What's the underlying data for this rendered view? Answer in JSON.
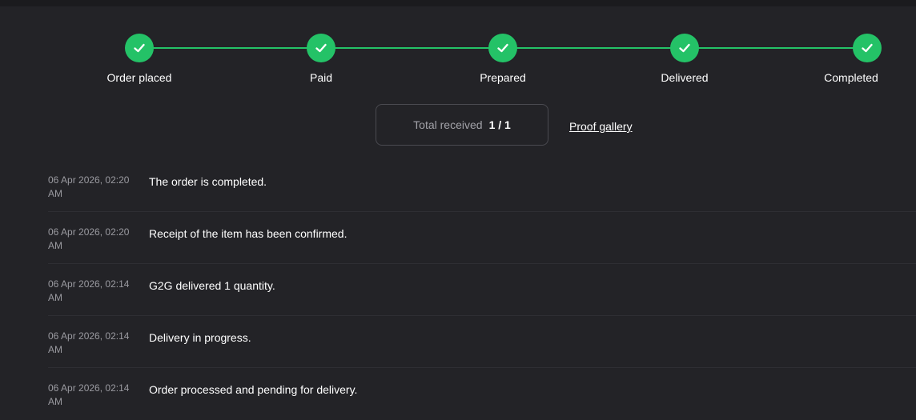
{
  "stepper": {
    "color": "#24c267",
    "steps": [
      {
        "label": "Order placed",
        "status": "done",
        "icon": "check-icon"
      },
      {
        "label": "Paid",
        "status": "done",
        "icon": "check-icon"
      },
      {
        "label": "Prepared",
        "status": "done",
        "icon": "check-icon"
      },
      {
        "label": "Delivered",
        "status": "done",
        "icon": "check-icon"
      },
      {
        "label": "Completed",
        "status": "done",
        "icon": "check-icon"
      }
    ]
  },
  "summary": {
    "total_label": "Total received",
    "total_value": "1 / 1",
    "proof_link": "Proof gallery"
  },
  "log": [
    {
      "time": "06 Apr 2026, 02:20 AM",
      "message": "The order is completed."
    },
    {
      "time": "06 Apr 2026, 02:20 AM",
      "message": "Receipt of the item has been confirmed."
    },
    {
      "time": "06 Apr 2026, 02:14 AM",
      "message": "G2G delivered 1 quantity."
    },
    {
      "time": "06 Apr 2026, 02:14 AM",
      "message": "Delivery in progress."
    },
    {
      "time": "06 Apr 2026, 02:14 AM",
      "message": "Order processed and pending for delivery."
    }
  ]
}
